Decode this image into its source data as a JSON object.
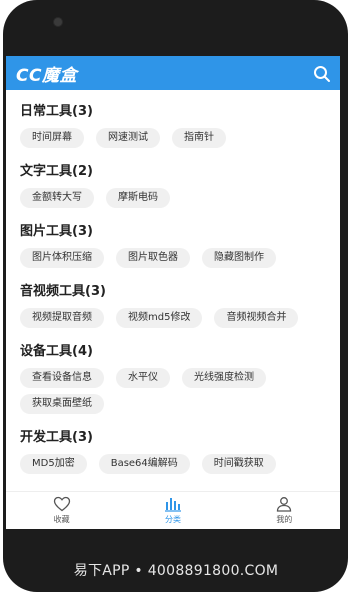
{
  "app": {
    "title": "CC魔盒"
  },
  "colors": {
    "accent": "#2f95e8",
    "chip_bg": "#f0f0f0"
  },
  "search": {
    "icon": "search-icon"
  },
  "sections": [
    {
      "title": "日常工具(3)",
      "items": [
        "时间屏幕",
        "网速测试",
        "指南针"
      ]
    },
    {
      "title": "文字工具(2)",
      "items": [
        "金额转大写",
        "摩斯电码"
      ]
    },
    {
      "title": "图片工具(3)",
      "items": [
        "图片体积压缩",
        "图片取色器",
        "隐藏图制作"
      ]
    },
    {
      "title": "音视频工具(3)",
      "items": [
        "视频提取音频",
        "视频md5修改",
        "音频视频合并"
      ]
    },
    {
      "title": "设备工具(4)",
      "items": [
        "查看设备信息",
        "水平仪",
        "光线强度检测",
        "获取桌面壁纸"
      ]
    },
    {
      "title": "开发工具(3)",
      "items": [
        "MD5加密",
        "Base64编解码",
        "时间戳获取"
      ]
    }
  ],
  "nav": [
    {
      "label": "收藏",
      "icon": "heart-icon",
      "active": false
    },
    {
      "label": "分类",
      "icon": "category-chart-icon",
      "active": true
    },
    {
      "label": "我的",
      "icon": "user-icon",
      "active": false
    }
  ],
  "watermark": "易下APP • 4008891800.COM"
}
